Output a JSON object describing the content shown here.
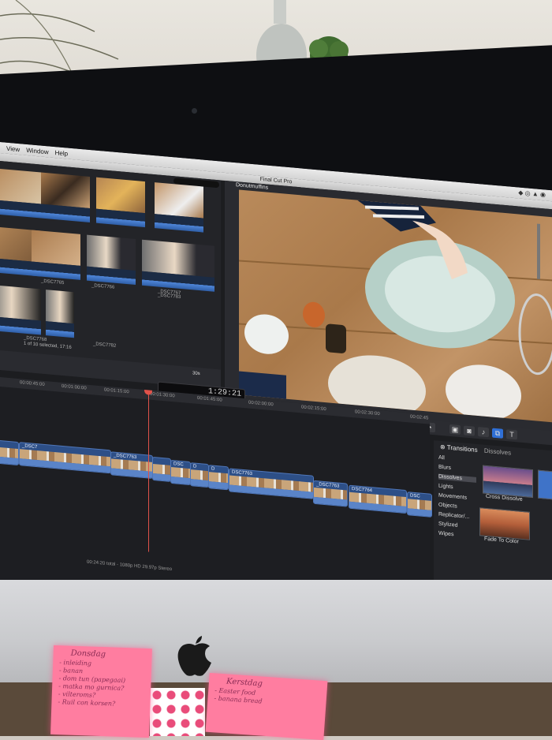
{
  "menubar": {
    "items": [
      "View",
      "Window",
      "Help"
    ]
  },
  "window": {
    "title": "Final Cut Pro"
  },
  "browser": {
    "clips": [
      {
        "name": ""
      },
      {
        "name": ""
      },
      {
        "name": ""
      },
      {
        "name": ""
      },
      {
        "name": "_DSC7765"
      },
      {
        "name": "_DSC7766"
      },
      {
        "name": "_DSC7767"
      },
      {
        "name": "_DSC7768"
      },
      {
        "name": "_DSC7782"
      },
      {
        "name": "_DSC7783"
      },
      {
        "name": ""
      },
      {
        "name": ""
      }
    ],
    "status": "1 of 10 selected, 17:16",
    "zoom_label": "30s"
  },
  "viewer": {
    "title": "Donutmuffins"
  },
  "timecode": "1:29:21",
  "timeline": {
    "ruler": [
      "00:00:45:00",
      "00:01:00:00",
      "00:01:15:00",
      "00:01:30:00",
      "00:01:45:00",
      "00:02:00:00",
      "00:02:15:00",
      "00:02:30:00",
      "00:02:45"
    ],
    "clips": [
      "_DSC7",
      "_DSC7763",
      "_DSC7763",
      "DSC",
      "D",
      "D",
      "DSC7763",
      "_DSC7763",
      "DSC7764",
      "DSC"
    ],
    "status": "00:24:20 total - 1080p HD 29.97p Stereo"
  },
  "transitions": {
    "tab_active": "Transitions",
    "tab_other": "Dissolves",
    "categories": [
      "All",
      "Blurs",
      "Dissolves",
      "Lights",
      "Movements",
      "Objects",
      "Replicator/...",
      "Stylized",
      "Wipes"
    ],
    "selected_category": "Dissolves",
    "effects": [
      {
        "label": "Cross Dissolve"
      },
      {
        "label": "Fade To Color"
      }
    ]
  },
  "notes": {
    "note1": {
      "heading": "Donsdag",
      "lines": [
        "- inleiding",
        "- banan",
        "- dom tun (papegaai)",
        "- matka mo gurnica?",
        "- vilteroms?",
        "- Ruil con korsen?"
      ]
    },
    "note2": {
      "heading": "Kerstdag",
      "lines": [
        "- Easter food",
        "- banana bread"
      ]
    }
  },
  "colors": {
    "accent": "#2f6fd6",
    "playhead": "#e0524a",
    "clip": "#2d4f87",
    "sticky": "#ff7da0"
  }
}
